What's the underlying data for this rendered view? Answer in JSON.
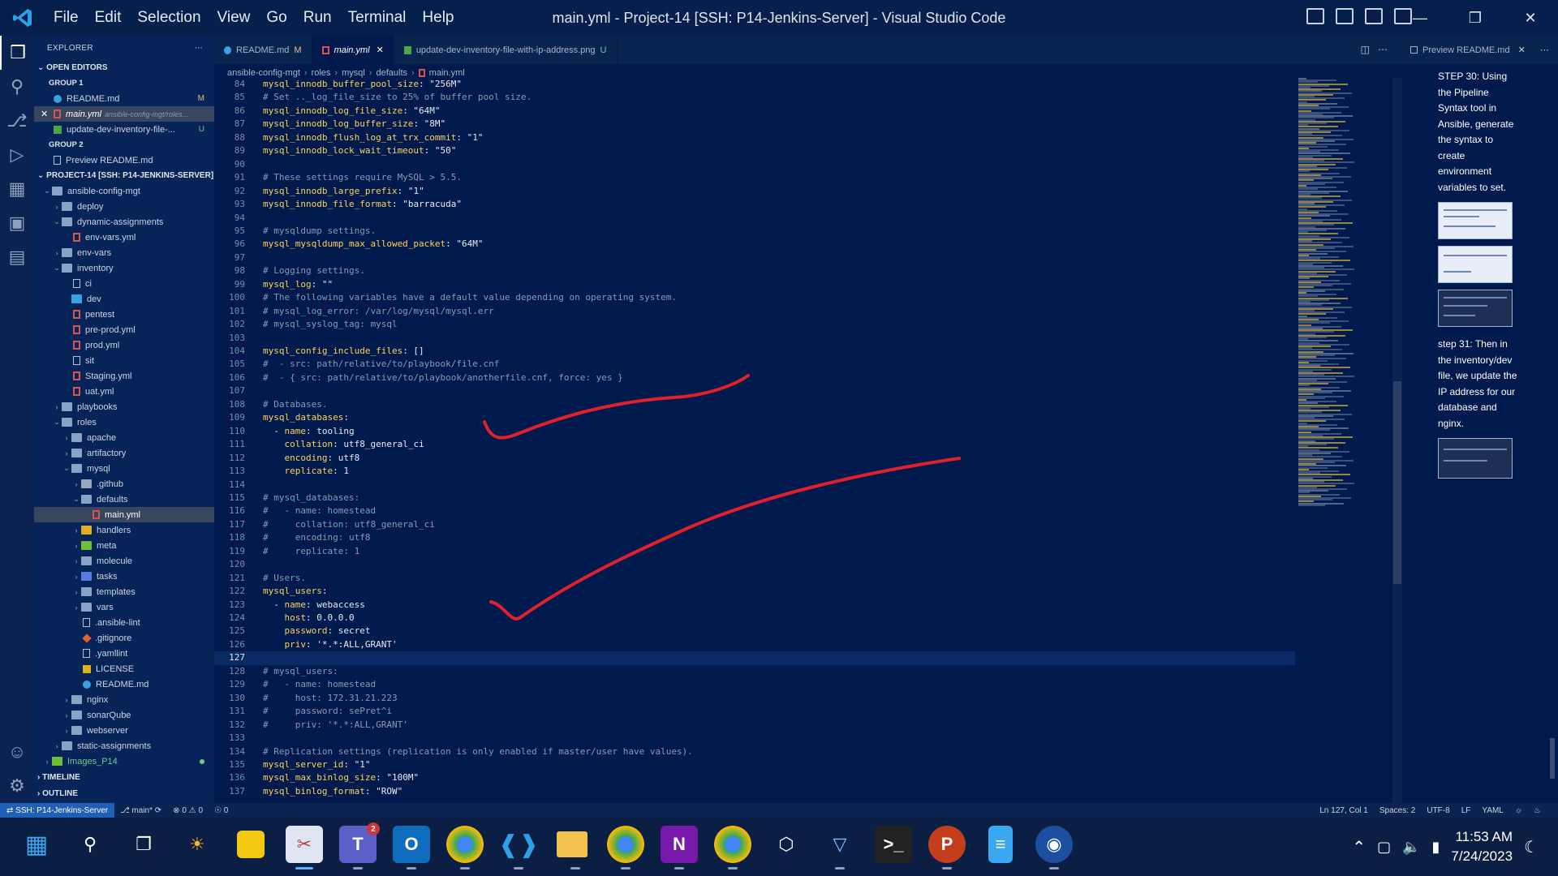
{
  "window": {
    "title": "main.yml - Project-14 [SSH: P14-Jenkins-Server] - Visual Studio Code",
    "menu": [
      "File",
      "Edit",
      "Selection",
      "View",
      "Go",
      "Run",
      "Terminal",
      "Help"
    ]
  },
  "explorer": {
    "header": "EXPLORER",
    "open_editors_label": "OPEN EDITORS",
    "group1_label": "GROUP 1",
    "group2_label": "GROUP 2",
    "open_editors_group1": [
      {
        "label": "README.md",
        "badge": "M",
        "icon": "info-icon"
      },
      {
        "label": "main.yml",
        "desc": "ansible-config-mgt/roles...",
        "icon": "yaml-icon"
      },
      {
        "label": "update-dev-inventory-file-...",
        "badge": "U",
        "icon": "image-icon"
      }
    ],
    "open_editors_group2": [
      {
        "label": "Preview README.md",
        "icon": "preview-icon"
      }
    ],
    "project_label": "PROJECT-14 [SSH: P14-JENKINS-SERVER]",
    "tree": [
      {
        "label": "ansible-config-mgt",
        "depth": 1,
        "type": "folder",
        "open": true
      },
      {
        "label": "deploy",
        "depth": 2,
        "type": "folder"
      },
      {
        "label": "dynamic-assignments",
        "depth": 2,
        "type": "folder",
        "open": true
      },
      {
        "label": "env-vars.yml",
        "depth": 3,
        "type": "yml"
      },
      {
        "label": "env-vars",
        "depth": 2,
        "type": "folder"
      },
      {
        "label": "inventory",
        "depth": 2,
        "type": "folder",
        "open": true
      },
      {
        "label": "ci",
        "depth": 3,
        "type": "file"
      },
      {
        "label": "dev",
        "depth": 3,
        "type": "docker"
      },
      {
        "label": "pentest",
        "depth": 3,
        "type": "yml"
      },
      {
        "label": "pre-prod.yml",
        "depth": 3,
        "type": "yml"
      },
      {
        "label": "prod.yml",
        "depth": 3,
        "type": "yml"
      },
      {
        "label": "sit",
        "depth": 3,
        "type": "file"
      },
      {
        "label": "Staging.yml",
        "depth": 3,
        "type": "yml"
      },
      {
        "label": "uat.yml",
        "depth": 3,
        "type": "yml"
      },
      {
        "label": "playbooks",
        "depth": 2,
        "type": "folder"
      },
      {
        "label": "roles",
        "depth": 2,
        "type": "folder",
        "open": true
      },
      {
        "label": "apache",
        "depth": 3,
        "type": "folder"
      },
      {
        "label": "artifactory",
        "depth": 3,
        "type": "folder"
      },
      {
        "label": "mysql",
        "depth": 3,
        "type": "folder",
        "open": true
      },
      {
        "label": ".github",
        "depth": 4,
        "type": "folder-git"
      },
      {
        "label": "defaults",
        "depth": 4,
        "type": "folder",
        "open": true
      },
      {
        "label": "main.yml",
        "depth": 5,
        "type": "yml",
        "selected": true
      },
      {
        "label": "handlers",
        "depth": 4,
        "type": "folder-yellow"
      },
      {
        "label": "meta",
        "depth": 4,
        "type": "folder-green"
      },
      {
        "label": "molecule",
        "depth": 4,
        "type": "folder"
      },
      {
        "label": "tasks",
        "depth": 4,
        "type": "folder-blue"
      },
      {
        "label": "templates",
        "depth": 4,
        "type": "folder"
      },
      {
        "label": "vars",
        "depth": 4,
        "type": "folder"
      },
      {
        "label": ".ansible-lint",
        "depth": 4,
        "type": "file"
      },
      {
        "label": ".gitignore",
        "depth": 4,
        "type": "git"
      },
      {
        "label": ".yamllint",
        "depth": 4,
        "type": "file"
      },
      {
        "label": "LICENSE",
        "depth": 4,
        "type": "license"
      },
      {
        "label": "README.md",
        "depth": 4,
        "type": "info"
      },
      {
        "label": "nginx",
        "depth": 3,
        "type": "folder"
      },
      {
        "label": "sonarQube",
        "depth": 3,
        "type": "folder"
      },
      {
        "label": "webserver",
        "depth": 3,
        "type": "folder"
      },
      {
        "label": "static-assignments",
        "depth": 2,
        "type": "folder"
      },
      {
        "label": "Images_P14",
        "depth": 1,
        "type": "folder-green",
        "dot": true
      }
    ],
    "timeline_label": "TIMELINE",
    "outline_label": "OUTLINE"
  },
  "tabs": [
    {
      "label": "README.md",
      "badge": "M",
      "active": false
    },
    {
      "label": "main.yml",
      "active": true
    },
    {
      "label": "update-dev-inventory-file-with-ip-address.png",
      "badge": "U",
      "active": false
    }
  ],
  "breadcrumb": [
    "ansible-config-mgt",
    "roles",
    "mysql",
    "defaults",
    "main.yml"
  ],
  "editor": {
    "current_line": 127,
    "lines": [
      {
        "n": 84,
        "t": "mysql_innodb_buffer_pool_size: \"256M\""
      },
      {
        "n": 85,
        "t": "# Set .._log_file_size to 25% of buffer pool size."
      },
      {
        "n": 86,
        "t": "mysql_innodb_log_file_size: \"64M\""
      },
      {
        "n": 87,
        "t": "mysql_innodb_log_buffer_size: \"8M\""
      },
      {
        "n": 88,
        "t": "mysql_innodb_flush_log_at_trx_commit: \"1\""
      },
      {
        "n": 89,
        "t": "mysql_innodb_lock_wait_timeout: \"50\""
      },
      {
        "n": 90,
        "t": ""
      },
      {
        "n": 91,
        "t": "# These settings require MySQL > 5.5."
      },
      {
        "n": 92,
        "t": "mysql_innodb_large_prefix: \"1\""
      },
      {
        "n": 93,
        "t": "mysql_innodb_file_format: \"barracuda\""
      },
      {
        "n": 94,
        "t": ""
      },
      {
        "n": 95,
        "t": "# mysqldump settings."
      },
      {
        "n": 96,
        "t": "mysql_mysqldump_max_allowed_packet: \"64M\""
      },
      {
        "n": 97,
        "t": ""
      },
      {
        "n": 98,
        "t": "# Logging settings."
      },
      {
        "n": 99,
        "t": "mysql_log: \"\""
      },
      {
        "n": 100,
        "t": "# The following variables have a default value depending on operating system."
      },
      {
        "n": 101,
        "t": "# mysql_log_error: /var/log/mysql/mysql.err"
      },
      {
        "n": 102,
        "t": "# mysql_syslog_tag: mysql"
      },
      {
        "n": 103,
        "t": ""
      },
      {
        "n": 104,
        "t": "mysql_config_include_files: []"
      },
      {
        "n": 105,
        "t": "#  - src: path/relative/to/playbook/file.cnf"
      },
      {
        "n": 106,
        "t": "#  - { src: path/relative/to/playbook/anotherfile.cnf, force: yes }"
      },
      {
        "n": 107,
        "t": ""
      },
      {
        "n": 108,
        "t": "# Databases."
      },
      {
        "n": 109,
        "t": "mysql_databases:"
      },
      {
        "n": 110,
        "t": "  - name: tooling"
      },
      {
        "n": 111,
        "t": "    collation: utf8_general_ci"
      },
      {
        "n": 112,
        "t": "    encoding: utf8"
      },
      {
        "n": 113,
        "t": "    replicate: 1"
      },
      {
        "n": 114,
        "t": ""
      },
      {
        "n": 115,
        "t": "# mysql_databases:"
      },
      {
        "n": 116,
        "t": "#   - name: homestead"
      },
      {
        "n": 117,
        "t": "#     collation: utf8_general_ci"
      },
      {
        "n": 118,
        "t": "#     encoding: utf8"
      },
      {
        "n": 119,
        "t": "#     replicate: 1"
      },
      {
        "n": 120,
        "t": ""
      },
      {
        "n": 121,
        "t": "# Users."
      },
      {
        "n": 122,
        "t": "mysql_users:"
      },
      {
        "n": 123,
        "t": "  - name: webaccess"
      },
      {
        "n": 124,
        "t": "    host: 0.0.0.0"
      },
      {
        "n": 125,
        "t": "    password: secret"
      },
      {
        "n": 126,
        "t": "    priv: '*.*:ALL,GRANT'"
      },
      {
        "n": 127,
        "t": ""
      },
      {
        "n": 128,
        "t": "# mysql_users:"
      },
      {
        "n": 129,
        "t": "#   - name: homestead"
      },
      {
        "n": 130,
        "t": "#     host: 172.31.21.223"
      },
      {
        "n": 131,
        "t": "#     password: sePret^i"
      },
      {
        "n": 132,
        "t": "#     priv: '*.*:ALL,GRANT'"
      },
      {
        "n": 133,
        "t": ""
      },
      {
        "n": 134,
        "t": "# Replication settings (replication is only enabled if master/user have values)."
      },
      {
        "n": 135,
        "t": "mysql_server_id: \"1\""
      },
      {
        "n": 136,
        "t": "mysql_max_binlog_size: \"100M\""
      },
      {
        "n": 137,
        "t": "mysql_binlog_format: \"ROW\""
      }
    ]
  },
  "preview": {
    "tab_label": "Preview README.md",
    "step30": "STEP 30: Using the Pipeline Syntax tool in Ansible, generate the syntax to create environment variables to set.",
    "step31": "step 31: Then in the inventory/dev file, we update the IP address for our database and nginx."
  },
  "statusbar": {
    "remote": "SSH: P14-Jenkins-Server",
    "branch": "main*",
    "errors": "0",
    "warnings": "0",
    "ports": "0",
    "position": "Ln 127, Col 1",
    "spaces": "Spaces: 2",
    "encoding": "UTF-8",
    "eol": "LF",
    "language": "YAML"
  },
  "taskbar": {
    "time": "11:53 AM",
    "date": "7/24/2023",
    "teams_badge": "2"
  },
  "colors": {
    "editor_bg": "#001a4d",
    "annotation": "#e0202a",
    "key": "#ffd35c"
  }
}
